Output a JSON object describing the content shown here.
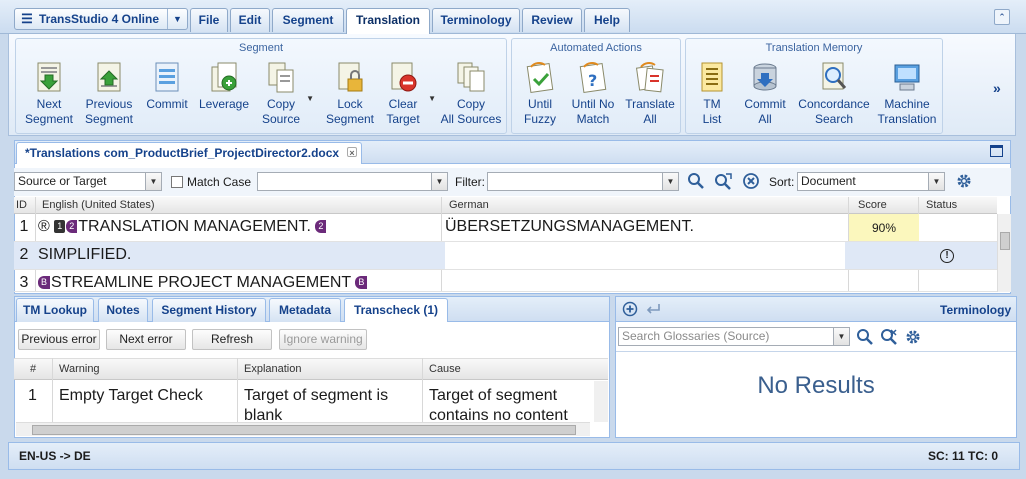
{
  "app": {
    "title": "TransStudio 4 Online"
  },
  "menu_tabs": [
    "File",
    "Edit",
    "Segment",
    "Translation",
    "Terminology",
    "Review",
    "Help"
  ],
  "active_menu_tab": "Translation",
  "ribbon": {
    "segment_group": {
      "title": "Segment",
      "buttons": [
        {
          "line1": "Next",
          "line2": "Segment"
        },
        {
          "line1": "Previous",
          "line2": "Segment"
        },
        {
          "line1": "Commit",
          "line2": ""
        },
        {
          "line1": "Leverage",
          "line2": ""
        },
        {
          "line1": "Copy",
          "line2": "Source"
        },
        {
          "line1": "Lock",
          "line2": "Segment"
        },
        {
          "line1": "Clear",
          "line2": "Target"
        },
        {
          "line1": "Copy",
          "line2": "All Sources"
        }
      ]
    },
    "automated_group": {
      "title": "Automated Actions",
      "buttons": [
        {
          "line1": "Until",
          "line2": "Fuzzy"
        },
        {
          "line1": "Until No",
          "line2": "Match"
        },
        {
          "line1": "Translate",
          "line2": "All"
        }
      ]
    },
    "tm_group": {
      "title": "Translation Memory",
      "buttons": [
        {
          "line1": "TM",
          "line2": "List"
        },
        {
          "line1": "Commit",
          "line2": "All"
        },
        {
          "line1": "Concordance",
          "line2": "Search"
        },
        {
          "line1": "Machine",
          "line2": "Translation"
        }
      ]
    },
    "more": "»"
  },
  "document": {
    "tab_title": "*Translations com_ProductBrief_ProjectDirector2.docx",
    "close": "×"
  },
  "filterbar": {
    "scope_value": "Source or Target",
    "match_case_label": "Match Case",
    "search_value": "",
    "filter_label": "Filter:",
    "filter_value": "",
    "sort_label": "Sort:",
    "sort_value": "Document"
  },
  "grid": {
    "headers": {
      "id": "ID",
      "source": "English (United States)",
      "target": "German",
      "score": "Score",
      "status": "Status"
    },
    "rows": [
      {
        "id": "1",
        "source": "TRANSLATION MANAGEMENT.",
        "target": "ÜBERSETZUNGSMANAGEMENT.",
        "score": "90%",
        "status": ""
      },
      {
        "id": "2",
        "source": "SIMPLIFIED.",
        "target": "",
        "score": "",
        "status": "!"
      },
      {
        "id": "3",
        "source": "STREAMLINE PROJECT MANAGEMENT",
        "target": "",
        "score": "",
        "status": ""
      }
    ],
    "tags": {
      "r": "®",
      "one": "1",
      "two": "2",
      "b": "B"
    }
  },
  "bottom_tabs": [
    "TM Lookup",
    "Notes",
    "Segment History",
    "Metadata",
    "Transcheck (1)"
  ],
  "active_bottom_tab": "Transcheck (1)",
  "transcheck": {
    "buttons": [
      "Previous error",
      "Next error",
      "Refresh",
      "Ignore warning"
    ],
    "headers": {
      "num": "#",
      "warning": "Warning",
      "explanation": "Explanation",
      "cause": "Cause"
    },
    "rows": [
      {
        "num": "1",
        "warning": "Empty Target Check",
        "explanation": "Target of segment is blank",
        "cause": "Target of segment contains no content"
      }
    ]
  },
  "terminology": {
    "title": "Terminology",
    "search_placeholder": "Search Glossaries (Source)",
    "no_results": "No Results"
  },
  "status": {
    "lang_pair": "EN-US -> DE",
    "counts": "SC: 11 TC: 0"
  },
  "colors": {
    "accent": "#15428b",
    "score_bg": "#fbf7bd",
    "selected_row": "#dfe8f6"
  }
}
